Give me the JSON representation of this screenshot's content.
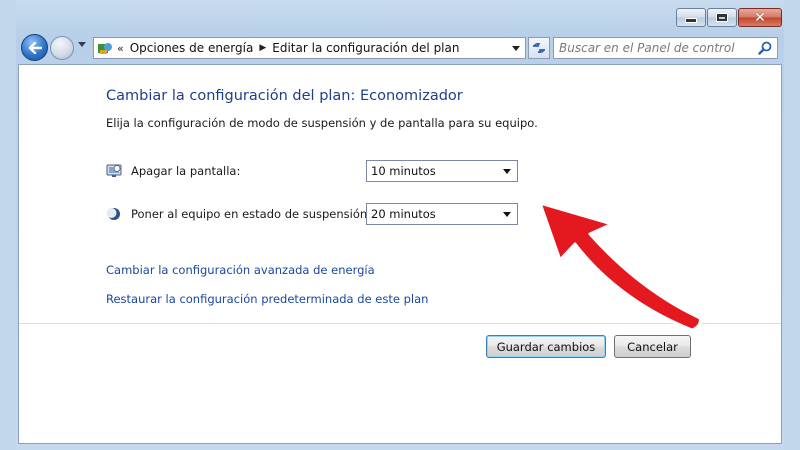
{
  "titlebar": {
    "buttons": [
      "minimize",
      "maximize",
      "close"
    ]
  },
  "navigation": {
    "breadcrumb_prefix": "«",
    "breadcrumbs": [
      "Opciones de energía",
      "Editar la configuración del plan"
    ],
    "search_placeholder": "Buscar en el Panel de control"
  },
  "main": {
    "title": "Cambiar la configuración del plan: Economizador",
    "subtitle": "Elija la configuración de modo de suspensión y de pantalla para su equipo.",
    "settings": [
      {
        "label": "Apagar la pantalla:",
        "value": "10 minutos",
        "icon": "monitor-icon"
      },
      {
        "label": "Poner al equipo en estado de suspensión:",
        "value": "20 minutos",
        "icon": "moon-icon"
      }
    ],
    "links": [
      "Cambiar la configuración avanzada de energía",
      "Restaurar la configuración predeterminada de este plan"
    ],
    "buttons": {
      "save": "Guardar cambios",
      "cancel": "Cancelar"
    }
  },
  "colors": {
    "heading": "#1e3f8a",
    "link": "#1a48a0",
    "annotation_arrow": "#e3191f"
  }
}
